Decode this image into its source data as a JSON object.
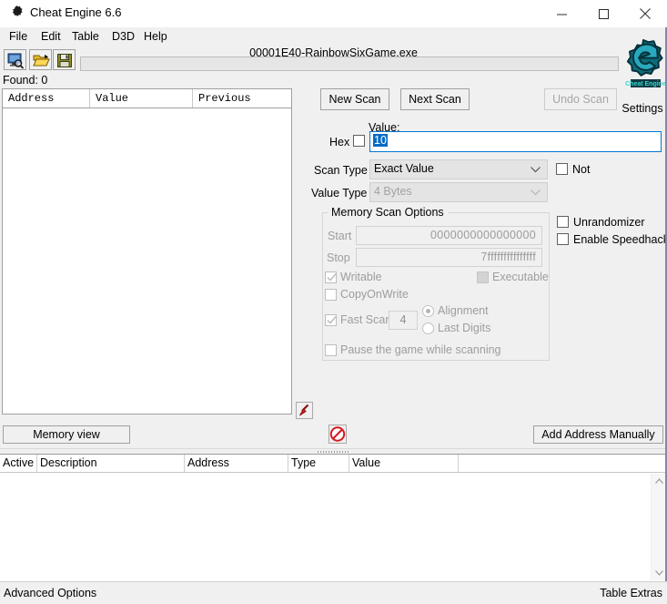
{
  "window": {
    "title": "Cheat Engine 6.6",
    "app_icon": "cheat-engine-icon",
    "controls": {
      "minimize": "minimize-icon",
      "maximize": "maximize-icon",
      "close": "close-icon"
    }
  },
  "menu": {
    "items": [
      {
        "label": "File"
      },
      {
        "label": "Edit"
      },
      {
        "label": "Table"
      },
      {
        "label": "D3D"
      },
      {
        "label": "Help"
      }
    ]
  },
  "toolbar": {
    "buttons": [
      {
        "name": "open-process-button",
        "icon": "process-select-icon"
      },
      {
        "name": "open-file-button",
        "icon": "open-folder-icon"
      },
      {
        "name": "save-file-button",
        "icon": "floppy-save-icon"
      }
    ]
  },
  "process": {
    "title": "00001E40-RainbowSixGame.exe",
    "progress_percent": 0
  },
  "results": {
    "found_label": "Found: 0",
    "columns": [
      "Address",
      "Value",
      "Previous"
    ],
    "rows": []
  },
  "scan": {
    "new_scan_label": "New Scan",
    "next_scan_label": "Next Scan",
    "undo_scan_label": "Undo Scan",
    "undo_scan_enabled": false,
    "value_label": "Value:",
    "value": "10",
    "hex_label": "Hex",
    "hex_checked": false,
    "scan_type_label": "Scan Type",
    "scan_type_value": "Exact Value",
    "not_label": "Not",
    "not_checked": false,
    "value_type_label": "Value Type",
    "value_type_value": "4 Bytes",
    "unrandomizer_label": "Unrandomizer",
    "unrandomizer_checked": false,
    "speedhack_label": "Enable Speedhack",
    "speedhack_checked": false
  },
  "memory_options": {
    "group_title": "Memory Scan Options",
    "start_label": "Start",
    "start_value": "0000000000000000",
    "stop_label": "Stop",
    "stop_value": "7fffffffffffffff",
    "writable_label": "Writable",
    "writable_checked": true,
    "executable_label": "Executable",
    "executable_state": "grayed",
    "copyonwrite_label": "CopyOnWrite",
    "copyonwrite_checked": false,
    "fast_scan_label": "Fast Scan",
    "fast_scan_checked": true,
    "fast_scan_value": "4",
    "alignment_label": "Alignment",
    "alignment_selected": true,
    "last_digits_label": "Last Digits",
    "last_digits_selected": false,
    "pause_game_label": "Pause the game while scanning",
    "pause_game_checked": false
  },
  "actions": {
    "add_to_list_icon": "red-arrow-down-icon",
    "stop_icon": "red-no-entry-icon",
    "memory_view_label": "Memory view",
    "add_address_label": "Add Address Manually"
  },
  "address_list": {
    "columns": [
      "Active",
      "Description",
      "Address",
      "Type",
      "Value"
    ],
    "rows": [],
    "scroll_up_icon": "chevron-up-icon",
    "scroll_down_icon": "chevron-down-icon"
  },
  "statusbar": {
    "left": "Advanced Options",
    "right": "Table Extras"
  },
  "branding": {
    "logo_icon": "cheat-engine-logo",
    "settings_label": "Settings",
    "logo_color": "#2a8f9e"
  }
}
